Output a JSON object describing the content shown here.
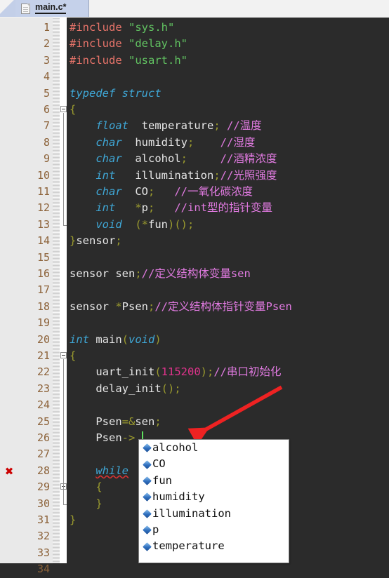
{
  "window": {
    "tab": {
      "label": "main.c*",
      "icon": "document-icon",
      "modified": true
    }
  },
  "editor": {
    "theme": {
      "background": "#2b2b2b",
      "gutter": "#e9e9e9",
      "line_number_color": "#8c6239",
      "keyword": "#3fa7d6",
      "preprocessor": "#e8746a",
      "string": "#62c462",
      "comment": "#e07ae0",
      "number": "#e0338c",
      "punctuation": "#9a9a2e",
      "identifier": "#e6e6e6",
      "caret": "#5ee05e",
      "error_marker": "#cc0000"
    },
    "first_line": 1,
    "last_line": 34,
    "caret": {
      "line": 26,
      "column": 11
    },
    "error_lines": [
      28
    ],
    "fold_lines": [
      6,
      21,
      29
    ],
    "lines": [
      {
        "n": "1",
        "tokens": [
          {
            "t": "#include ",
            "c": "pp"
          },
          {
            "t": "\"sys.h\"",
            "c": "str"
          }
        ]
      },
      {
        "n": "2",
        "tokens": [
          {
            "t": "#include ",
            "c": "pp"
          },
          {
            "t": "\"delay.h\"",
            "c": "str"
          }
        ]
      },
      {
        "n": "3",
        "tokens": [
          {
            "t": "#include ",
            "c": "pp"
          },
          {
            "t": "\"usart.h\"",
            "c": "str"
          }
        ]
      },
      {
        "n": "4",
        "tokens": []
      },
      {
        "n": "5",
        "tokens": [
          {
            "t": "typedef struct",
            "c": "kw"
          }
        ]
      },
      {
        "n": "6",
        "tokens": [
          {
            "t": "{",
            "c": "pun"
          }
        ]
      },
      {
        "n": "7",
        "tokens": [
          {
            "t": "    ",
            "c": "id"
          },
          {
            "t": "float",
            "c": "kw"
          },
          {
            "t": "  temperature",
            "c": "id"
          },
          {
            "t": ";",
            "c": "pun"
          },
          {
            "t": " //温度",
            "c": "cmt"
          }
        ]
      },
      {
        "n": "8",
        "tokens": [
          {
            "t": "    ",
            "c": "id"
          },
          {
            "t": "char",
            "c": "kw"
          },
          {
            "t": "  humidity",
            "c": "id"
          },
          {
            "t": ";",
            "c": "pun"
          },
          {
            "t": "    //湿度",
            "c": "cmt"
          }
        ]
      },
      {
        "n": "9",
        "tokens": [
          {
            "t": "    ",
            "c": "id"
          },
          {
            "t": "char",
            "c": "kw"
          },
          {
            "t": "  alcohol",
            "c": "id"
          },
          {
            "t": ";",
            "c": "pun"
          },
          {
            "t": "     //酒精浓度",
            "c": "cmt"
          }
        ]
      },
      {
        "n": "10",
        "tokens": [
          {
            "t": "    ",
            "c": "id"
          },
          {
            "t": "int",
            "c": "kw"
          },
          {
            "t": "   illumination",
            "c": "id"
          },
          {
            "t": ";",
            "c": "pun"
          },
          {
            "t": "//光照强度",
            "c": "cmt"
          }
        ]
      },
      {
        "n": "11",
        "tokens": [
          {
            "t": "    ",
            "c": "id"
          },
          {
            "t": "char",
            "c": "kw"
          },
          {
            "t": "  CO",
            "c": "id"
          },
          {
            "t": ";",
            "c": "pun"
          },
          {
            "t": "   //一氧化碳浓度",
            "c": "cmt"
          }
        ]
      },
      {
        "n": "12",
        "tokens": [
          {
            "t": "    ",
            "c": "id"
          },
          {
            "t": "int",
            "c": "kw"
          },
          {
            "t": "   ",
            "c": "id"
          },
          {
            "t": "*",
            "c": "pun"
          },
          {
            "t": "p",
            "c": "id"
          },
          {
            "t": ";",
            "c": "pun"
          },
          {
            "t": "   //int型的指针变量",
            "c": "cmt"
          }
        ]
      },
      {
        "n": "13",
        "tokens": [
          {
            "t": "    ",
            "c": "id"
          },
          {
            "t": "void",
            "c": "kw"
          },
          {
            "t": "  ",
            "c": "id"
          },
          {
            "t": "(",
            "c": "pun"
          },
          {
            "t": "*",
            "c": "pun"
          },
          {
            "t": "fun",
            "c": "id"
          },
          {
            "t": ")();",
            "c": "pun"
          }
        ]
      },
      {
        "n": "14",
        "tokens": [
          {
            "t": "}",
            "c": "pun"
          },
          {
            "t": "sensor",
            "c": "id"
          },
          {
            "t": ";",
            "c": "pun"
          }
        ]
      },
      {
        "n": "15",
        "tokens": []
      },
      {
        "n": "16",
        "tokens": [
          {
            "t": "sensor sen",
            "c": "id"
          },
          {
            "t": ";",
            "c": "pun"
          },
          {
            "t": "//定义结构体变量sen",
            "c": "cmt"
          }
        ]
      },
      {
        "n": "17",
        "tokens": []
      },
      {
        "n": "18",
        "tokens": [
          {
            "t": "sensor ",
            "c": "id"
          },
          {
            "t": "*",
            "c": "pun"
          },
          {
            "t": "Psen",
            "c": "id"
          },
          {
            "t": ";",
            "c": "pun"
          },
          {
            "t": "//定义结构体指针变量Psen",
            "c": "cmt"
          }
        ]
      },
      {
        "n": "19",
        "tokens": []
      },
      {
        "n": "20",
        "tokens": [
          {
            "t": "int",
            "c": "kw"
          },
          {
            "t": " main",
            "c": "id"
          },
          {
            "t": "(",
            "c": "pun"
          },
          {
            "t": "void",
            "c": "kw"
          },
          {
            "t": ")",
            "c": "pun"
          }
        ]
      },
      {
        "n": "21",
        "tokens": [
          {
            "t": "{",
            "c": "pun"
          }
        ]
      },
      {
        "n": "22",
        "tokens": [
          {
            "t": "    uart_init",
            "c": "id"
          },
          {
            "t": "(",
            "c": "pun"
          },
          {
            "t": "115200",
            "c": "num"
          },
          {
            "t": ");",
            "c": "pun"
          },
          {
            "t": "//串口初始化",
            "c": "cmt"
          }
        ]
      },
      {
        "n": "23",
        "tokens": [
          {
            "t": "    delay_init",
            "c": "id"
          },
          {
            "t": "();",
            "c": "pun"
          }
        ]
      },
      {
        "n": "24",
        "tokens": []
      },
      {
        "n": "25",
        "tokens": [
          {
            "t": "    Psen",
            "c": "id"
          },
          {
            "t": "=&",
            "c": "pun"
          },
          {
            "t": "sen",
            "c": "id"
          },
          {
            "t": ";",
            "c": "pun"
          }
        ]
      },
      {
        "n": "26",
        "tokens": [
          {
            "t": "    Psen",
            "c": "id"
          },
          {
            "t": "->",
            "c": "pun"
          }
        ]
      },
      {
        "n": "27",
        "tokens": []
      },
      {
        "n": "28",
        "tokens": [
          {
            "t": "    ",
            "c": "id"
          },
          {
            "t": "while",
            "c": "kw sq"
          }
        ]
      },
      {
        "n": "29",
        "tokens": [
          {
            "t": "    {",
            "c": "pun"
          }
        ]
      },
      {
        "n": "30",
        "tokens": [
          {
            "t": "    }",
            "c": "pun"
          }
        ]
      },
      {
        "n": "31",
        "tokens": [
          {
            "t": "}",
            "c": "pun"
          }
        ]
      },
      {
        "n": "32",
        "tokens": []
      },
      {
        "n": "33",
        "tokens": []
      },
      {
        "n": "34",
        "tokens": []
      }
    ]
  },
  "autocomplete": {
    "visible": true,
    "icon": "member-diamond-icon",
    "items": [
      {
        "label": "alcohol"
      },
      {
        "label": "CO"
      },
      {
        "label": "fun"
      },
      {
        "label": "humidity"
      },
      {
        "label": "illumination"
      },
      {
        "label": "p"
      },
      {
        "label": "temperature"
      }
    ]
  },
  "annotation": {
    "arrow": {
      "color": "#ee2222",
      "points_to": "caret-line-26"
    }
  }
}
